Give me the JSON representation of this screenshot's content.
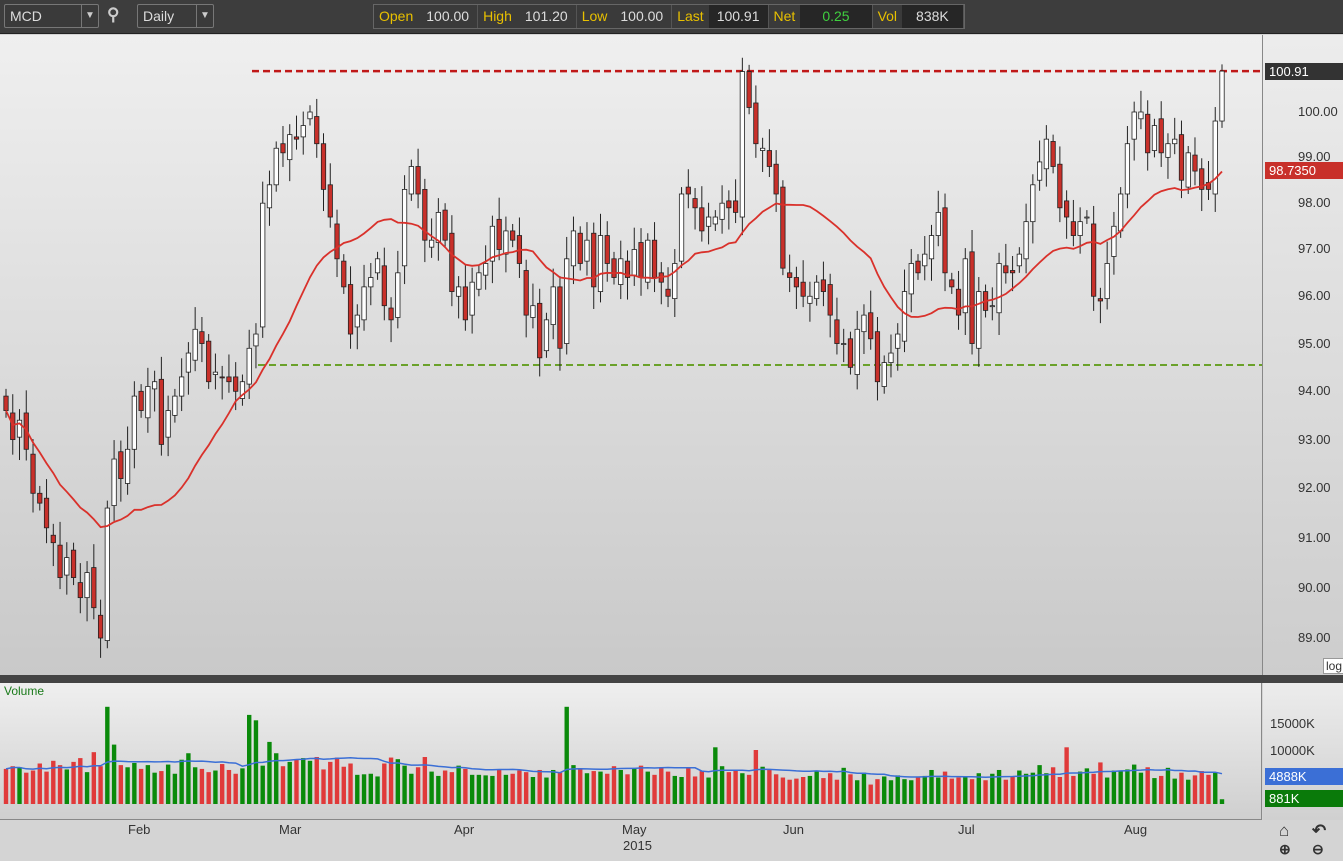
{
  "toolbar": {
    "symbol": "MCD",
    "interval": "Daily",
    "quote": {
      "open_label": "Open",
      "open": "100.00",
      "high_label": "High",
      "high": "101.20",
      "low_label": "Low",
      "low": "100.00",
      "last_label": "Last",
      "last": "100.91",
      "net_label": "Net",
      "net": "0.25",
      "vol_label": "Vol",
      "vol": "838K"
    }
  },
  "colors": {
    "up": "#ffffff",
    "down": "#c8302a",
    "ma": "#d9312b",
    "vol_up": "#0a8a0a",
    "vol_down": "#e03a3a",
    "vol_ma": "#3b6fd6",
    "resistance": "#c01818",
    "support": "#6aa12a"
  },
  "price_panel": {
    "scale": "log",
    "last_tag": "100.91",
    "ma_tag": "98.7350"
  },
  "volume_panel": {
    "title": "Volume",
    "avg_tag": "4888K",
    "last_tag": "881K",
    "ticks": [
      "15000K",
      "10000K"
    ]
  },
  "x_axis": {
    "months": [
      "Feb",
      "Mar",
      "Apr",
      "May",
      "Jun",
      "Jul",
      "Aug"
    ],
    "year": "2015"
  },
  "chart_data": {
    "type": "candlestick",
    "title": "MCD Daily",
    "ylim": [
      88.3,
      102.4
    ],
    "yticks": [
      89,
      90,
      91,
      92,
      93,
      94,
      95,
      96,
      97,
      98,
      99,
      100
    ],
    "ytick_labels": [
      "89.00",
      "90.00",
      "91.00",
      "92.00",
      "93.00",
      "94.00",
      "95.00",
      "96.00",
      "97.00",
      "98.00",
      "99.00",
      "100.00"
    ],
    "resistance": 100.91,
    "support": 94.55,
    "ma_period": 20,
    "close": [
      93.6,
      93.0,
      93.4,
      92.8,
      91.9,
      91.7,
      91.2,
      90.9,
      90.2,
      90.6,
      90.2,
      89.8,
      90.3,
      89.6,
      89.0,
      91.6,
      92.6,
      92.2,
      92.8,
      93.9,
      93.6,
      94.1,
      94.2,
      92.9,
      93.6,
      93.9,
      94.3,
      94.8,
      95.3,
      95.0,
      94.2,
      94.4,
      94.3,
      94.2,
      94.0,
      94.2,
      94.9,
      95.2,
      98.0,
      98.4,
      99.2,
      99.1,
      99.5,
      99.4,
      99.7,
      100.0,
      99.3,
      98.3,
      97.7,
      96.8,
      96.2,
      95.2,
      95.6,
      96.2,
      96.4,
      96.8,
      95.8,
      95.5,
      96.5,
      98.3,
      98.8,
      98.2,
      97.2,
      97.2,
      97.8,
      97.2,
      96.1,
      96.2,
      95.5,
      96.3,
      96.5,
      96.7,
      97.5,
      97.0,
      97.4,
      97.2,
      96.7,
      95.6,
      95.8,
      94.7,
      95.5,
      96.2,
      94.9,
      96.8,
      97.4,
      96.7,
      97.2,
      96.2,
      97.3,
      96.7,
      96.4,
      96.8,
      96.4,
      97.0,
      96.4,
      97.2,
      96.4,
      96.3,
      96.0,
      96.7,
      98.2,
      98.2,
      97.9,
      97.4,
      97.7,
      97.7,
      98.0,
      97.9,
      97.8,
      100.9,
      100.1,
      99.3,
      99.2,
      98.8,
      98.2,
      96.6,
      96.4,
      96.2,
      96.0,
      96.0,
      96.3,
      96.1,
      95.6,
      95.0,
      95.0,
      94.5,
      95.3,
      95.6,
      95.1,
      94.2,
      94.6,
      94.8,
      95.2,
      96.1,
      96.7,
      96.5,
      96.9,
      97.3,
      97.8,
      96.5,
      96.2,
      95.6,
      96.8,
      95.0,
      96.1,
      95.7,
      95.8,
      96.7,
      96.5,
      96.5,
      96.9,
      97.6,
      98.4,
      98.9,
      99.4,
      98.8,
      97.9,
      97.7,
      97.3,
      97.6,
      97.7,
      96.0,
      95.9,
      96.7,
      97.5,
      98.2,
      99.3,
      100.0,
      100.0,
      99.1,
      99.7,
      99.1,
      99.3,
      99.4,
      98.5,
      99.1,
      98.7,
      98.3,
      98.3,
      99.8,
      100.91
    ],
    "volume_k": [
      6500,
      7000,
      6800,
      5800,
      6200,
      7500,
      6000,
      8000,
      7200,
      6400,
      7800,
      8500,
      5900,
      9600,
      7000,
      18000,
      11000,
      7200,
      6800,
      7600,
      6500,
      7200,
      5800,
      6100,
      7300,
      5600,
      8200,
      9400,
      6800,
      6500,
      5900,
      6200,
      7400,
      6300,
      5600,
      6600,
      16500,
      15500,
      7100,
      11500,
      9400,
      7000,
      7800,
      8200,
      8500,
      8000,
      8700,
      6400,
      7800,
      8600,
      6900,
      7500,
      5400,
      5500,
      5600,
      5100,
      7500,
      8600,
      8300,
      7100,
      5600,
      6800,
      8700,
      6000,
      5200,
      6200,
      5900,
      7100,
      6500,
      5400,
      5400,
      5300,
      5200,
      6300,
      5400,
      5600,
      6200,
      5900,
      5000,
      6300,
      4900,
      6300,
      5800,
      18000,
      7200,
      6600,
      5700,
      6100,
      6000,
      5600,
      7000,
      6300,
      5500,
      6600,
      7100,
      6000,
      5400,
      6800,
      6000,
      5200,
      5000,
      6700,
      5100,
      6100,
      4900,
      10500,
      7000,
      5900,
      6200,
      5700,
      5400,
      10000,
      6900,
      6300,
      5500,
      4900,
      4500,
      4700,
      5000,
      5200,
      6200,
      4800,
      5700,
      4500,
      6700,
      5500,
      4400,
      5800,
      3600,
      4600,
      5100,
      4400,
      5300,
      4600,
      4400,
      4900,
      5200,
      6300,
      4900,
      6000,
      4700,
      4900,
      5100,
      4600,
      5700,
      4400,
      5600,
      6300,
      4500,
      5000,
      6200,
      5600,
      5800,
      7200,
      5700,
      6800,
      5000,
      10500,
      5200,
      6000,
      6600,
      5600,
      7700,
      4900,
      6200,
      6100,
      6400,
      7300,
      5800,
      6800,
      4800,
      5200,
      6700,
      4700,
      5800,
      4500,
      5300,
      6100,
      5400,
      5900,
      881
    ]
  }
}
